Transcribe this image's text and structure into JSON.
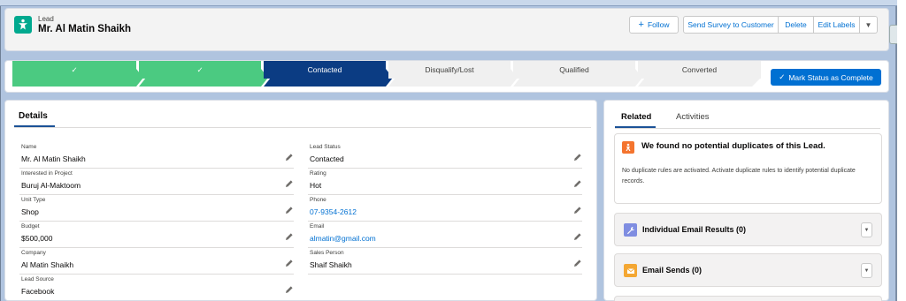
{
  "header": {
    "object_type": "Lead",
    "record_name": "Mr. Al Matin Shaikh",
    "actions": {
      "follow": "Follow",
      "send_survey": "Send Survey to Customer",
      "delete": "Delete",
      "edit_labels": "Edit Labels"
    }
  },
  "path": {
    "steps": [
      {
        "label": "",
        "state": "done"
      },
      {
        "label": "",
        "state": "done"
      },
      {
        "label": "Contacted",
        "state": "current"
      },
      {
        "label": "Disqualify/Lost",
        "state": "todo"
      },
      {
        "label": "Qualified",
        "state": "todo"
      },
      {
        "label": "Converted",
        "state": "todo"
      }
    ],
    "complete_button": "Mark Status as Complete"
  },
  "details": {
    "tab_label": "Details",
    "left": [
      {
        "label": "Name",
        "value": "Mr. Al Matin Shaikh"
      },
      {
        "label": "Interested in Project",
        "value": "Buruj Al-Maktoom"
      },
      {
        "label": "Unit Type",
        "value": "Shop"
      },
      {
        "label": "Budget",
        "value": "$500,000"
      },
      {
        "label": "Company",
        "value": "Al Matin Shaikh"
      },
      {
        "label": "Lead Source",
        "value": "Facebook"
      }
    ],
    "right": [
      {
        "label": "Lead Status",
        "value": "Contacted"
      },
      {
        "label": "Rating",
        "value": "Hot"
      },
      {
        "label": "Phone",
        "value": "07-9354-2612"
      },
      {
        "label": "Email",
        "value": "almatin@gmail.com"
      },
      {
        "label": "Sales Person",
        "value": "Shaif Shaikh"
      }
    ]
  },
  "related": {
    "tabs": [
      "Related",
      "Activities"
    ],
    "duplicates": {
      "title": "We found no potential duplicates of this Lead.",
      "body": "No duplicate rules are activated. Activate duplicate rules to identify potential duplicate records."
    },
    "lists": [
      {
        "title": "Individual Email Results (0)",
        "icon": "wrench-icon"
      },
      {
        "title": "Email Sends (0)",
        "icon": "email-icon"
      }
    ]
  },
  "colors": {
    "path_done": "#4bca81",
    "path_current": "#0b3c83",
    "brand": "#0070d2",
    "lead_icon": "#00a98f"
  }
}
